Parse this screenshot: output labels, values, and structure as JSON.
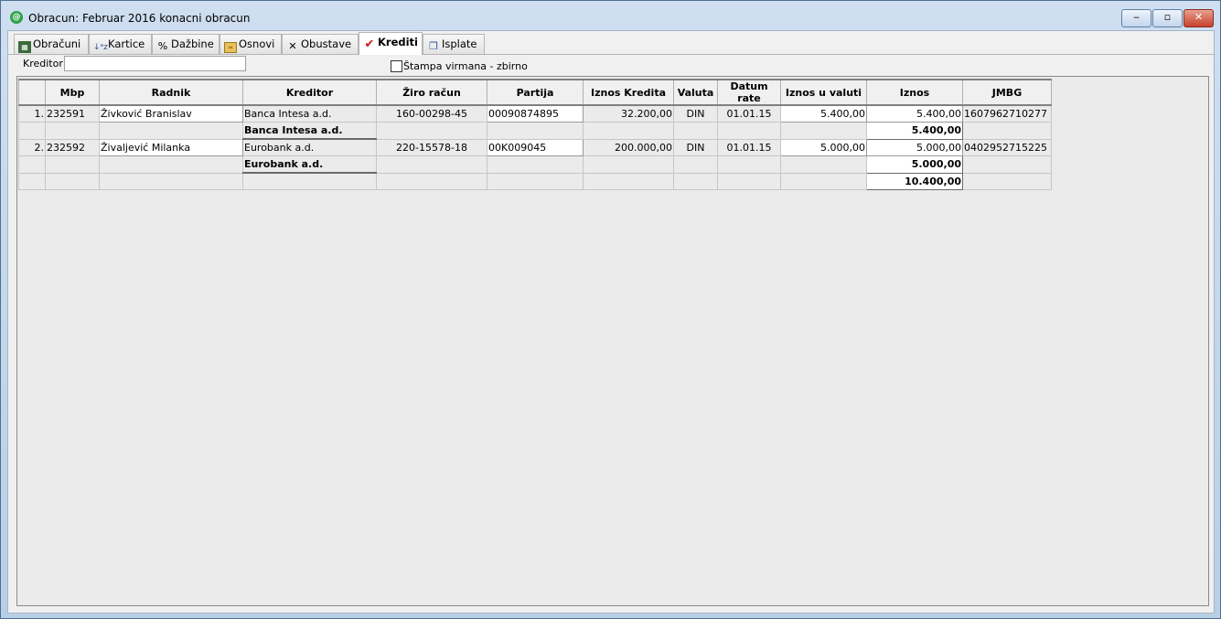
{
  "window": {
    "title": "Obracun: Februar 2016 konacni obracun",
    "app_icon_glyph": "@",
    "minimize_glyph": "‒",
    "maximize_glyph": "▫",
    "close_glyph": "✕"
  },
  "tabs": [
    {
      "label": "Obračuni",
      "icon": "calculator-icon"
    },
    {
      "label": "Kartice",
      "icon": "sort-az-icon"
    },
    {
      "label": "Dažbine",
      "icon": "percent-icon"
    },
    {
      "label": "Osnovi",
      "icon": "folder-icon"
    },
    {
      "label": "Obustave",
      "icon": "x-icon"
    },
    {
      "label": "Krediti",
      "icon": "check-icon"
    },
    {
      "label": "Isplate",
      "icon": "cards-icon"
    }
  ],
  "active_tab": "Krediti",
  "filter": {
    "kreditor_label": "Kreditor",
    "kreditor_value": "",
    "stampa_label": "Štampa virmana - zbirno",
    "stampa_checked": false
  },
  "grid": {
    "columns": [
      "Mbp",
      "Radnik",
      "Kreditor",
      "Žiro račun",
      "Partija",
      "Iznos Kredita",
      "Valuta",
      "Datum rate",
      "Iznos u valuti",
      "Iznos",
      "JMBG"
    ],
    "rows": [
      {
        "num": "1.",
        "mbp": "232591",
        "radnik": "Živković Branislav",
        "kreditor": "Banca Intesa a.d.",
        "ziro": "160-00298-45",
        "partija": "00090874895",
        "iznos_kredita": "32.200,00",
        "valuta": "DIN",
        "datum": "01.01.15",
        "iznos_valuti": "5.400,00",
        "iznos": "5.400,00",
        "jmbg": "1607962710277"
      },
      {
        "subtotal_kreditor": "Banca Intesa a.d.",
        "subtotal": "5.400,00"
      },
      {
        "num": "2.",
        "mbp": "232592",
        "radnik": "Živaljević Milanka",
        "kreditor": "Eurobank a.d.",
        "ziro": "220-15578-18",
        "partija": "00K009045",
        "iznos_kredita": "200.000,00",
        "valuta": "DIN",
        "datum": "01.01.15",
        "iznos_valuti": "5.000,00",
        "iznos": "5.000,00",
        "jmbg": "0402952715225"
      },
      {
        "subtotal_kreditor": "Eurobank a.d.",
        "subtotal": "5.000,00"
      },
      {
        "total": "10.400,00"
      }
    ]
  }
}
